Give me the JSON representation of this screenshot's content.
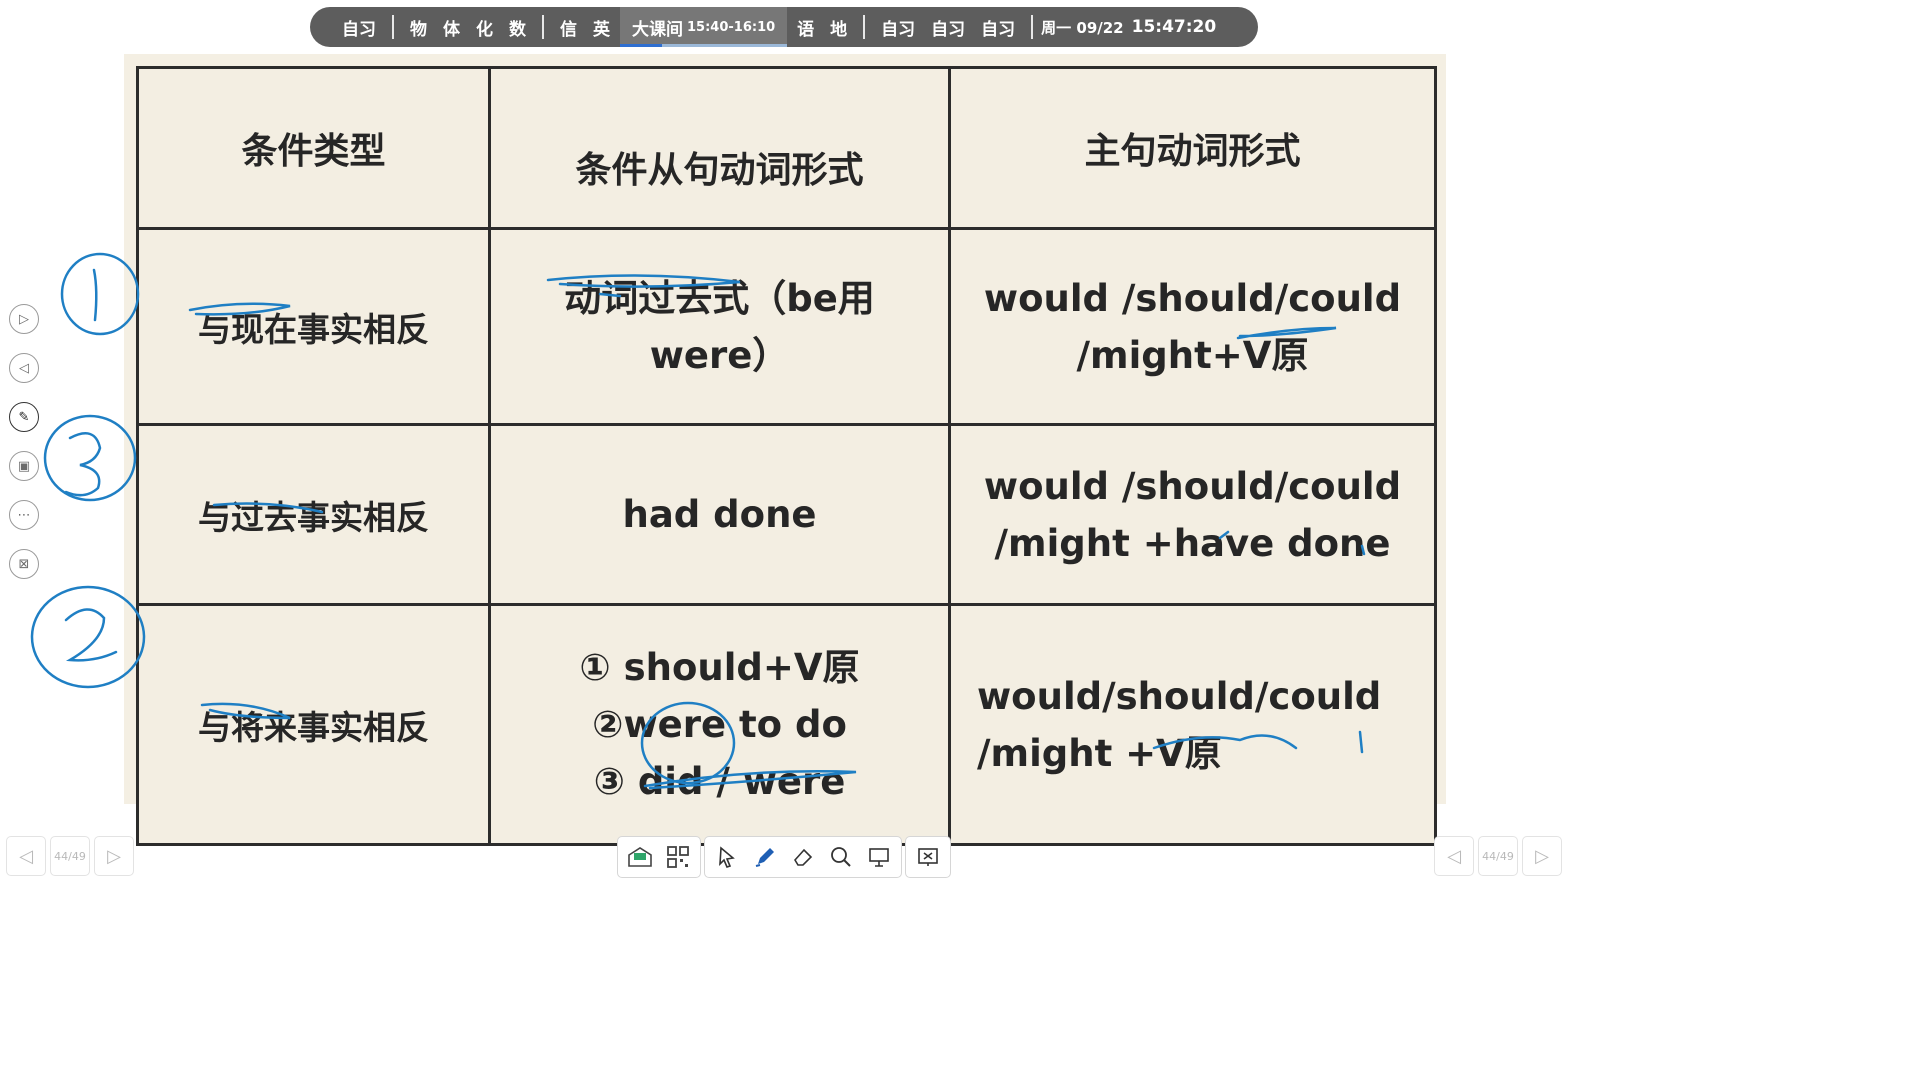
{
  "schedule": {
    "items_before": [
      "自习",
      "物",
      "体",
      "化",
      "数",
      "信",
      "英"
    ],
    "current": {
      "label": "大课间",
      "time": "15:40-16:10",
      "progress": 0.25
    },
    "items_after": [
      "语",
      "地",
      "自习",
      "自习",
      "自习"
    ],
    "date": "周一 09/22",
    "clock": "15:47:20"
  },
  "table": {
    "headers": [
      "条件类型",
      "条件从句动词形式",
      "主句动词形式"
    ],
    "rows": [
      {
        "type": "与现在事实相反",
        "clause": [
          "动词过去式（be用",
          "were）"
        ],
        "main": [
          "would /should/could",
          "/might+V原"
        ]
      },
      {
        "type": "与过去事实相反",
        "clause": [
          "had done"
        ],
        "main": [
          "would /should/could",
          "/might +have done"
        ]
      },
      {
        "type": "与将来事实相反",
        "clause": [
          "① should+V原",
          "②were to do",
          "③ did / were"
        ],
        "main": [
          "would/should/could",
          "/might +V原"
        ]
      }
    ]
  },
  "side_tools": [
    {
      "icon": "play-forward-icon"
    },
    {
      "icon": "play-back-icon"
    },
    {
      "icon": "pen-disabled-icon"
    },
    {
      "icon": "screen-select-icon"
    },
    {
      "icon": "more-icon"
    },
    {
      "icon": "screen-off-icon"
    }
  ],
  "pager": {
    "left": "44/49",
    "right": "44/49"
  },
  "toolbar": {
    "icons": [
      "checkin-icon",
      "qr-code-icon",
      "cursor-icon",
      "pen-icon",
      "eraser-icon",
      "search-icon",
      "projector-icon",
      "close-presentation-icon"
    ]
  },
  "colors": {
    "bar": "#5d5d5d",
    "ink": "#1f7fc4",
    "slide_bg": "#f4efe3"
  }
}
